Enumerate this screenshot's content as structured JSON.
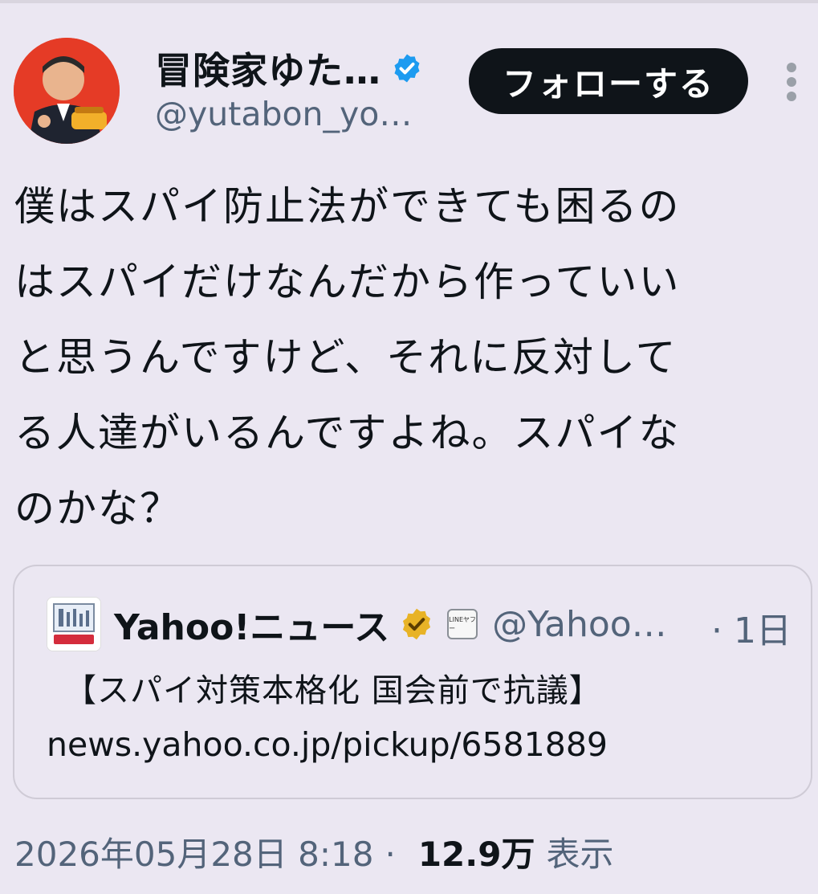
{
  "author": {
    "display_name": "冒険家ゆた…",
    "handle": "@yutabon_yo…",
    "verified_color": "#1d9bf0"
  },
  "follow_label": "フォローする",
  "tweet": {
    "text": "僕はスパイ防止法ができても困るの\nはスパイだけなんだから作っていい\nと思うんですけど、それに反対して\nる人達がいるんですよね。スパイな\nのかな？"
  },
  "quote": {
    "source_name": "Yahoo!ニュース",
    "badge_color": "#e8b326",
    "affiliate_label": "LINEヤフー",
    "handle": "@Yahoo…",
    "time": "· 1日",
    "headline": "【スパイ対策本格化 国会前で抗議】",
    "link": "news.yahoo.co.jp/pickup/6581889"
  },
  "meta": {
    "timestamp": "2026年05月28日 8:18",
    "separator": "·",
    "views_count": "12.9万",
    "views_label": "表示"
  },
  "colors": {
    "background": "#ebe7f2",
    "follow_button": "#0f1419",
    "secondary_text": "#53647a"
  }
}
